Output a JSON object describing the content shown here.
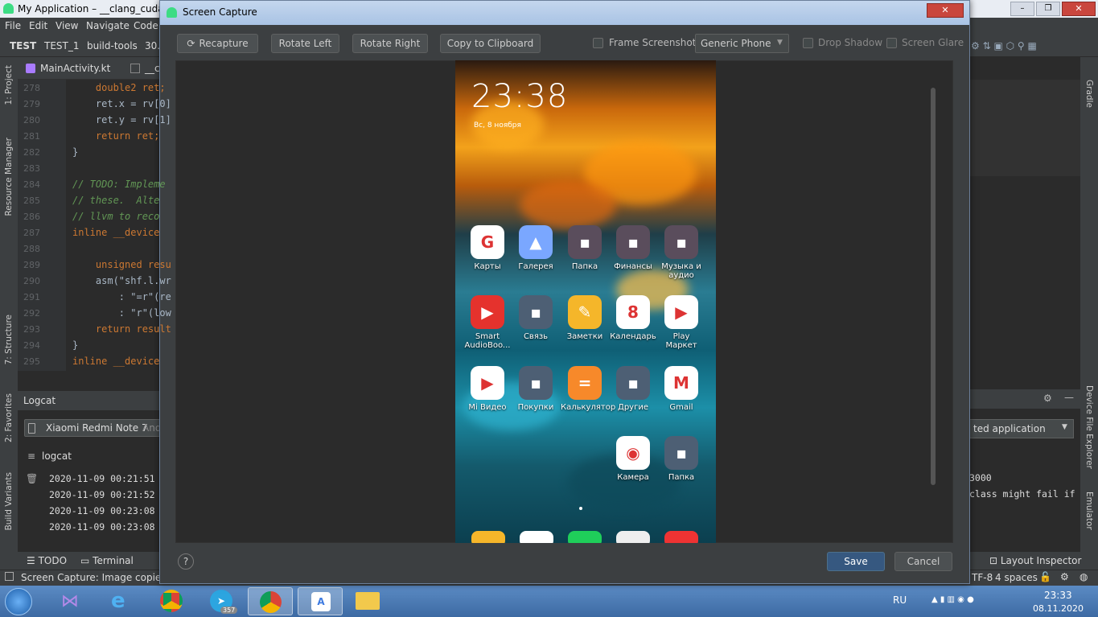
{
  "ide": {
    "title": "My Application – __clang_cuda_in",
    "menu": [
      "File",
      "Edit",
      "View",
      "Navigate",
      "Code"
    ],
    "breadcrumb": [
      "TEST",
      "TEST_1",
      "build-tools",
      "30."
    ],
    "tab_file": "MainActivity.kt",
    "tab_file2": "__c",
    "left_tools": [
      "1: Project",
      "Resource Manager",
      "7: Structure",
      "2: Favorites",
      "Build Variants"
    ],
    "right_tools": [
      "Gradle",
      "Device File Explorer",
      "Emulator"
    ],
    "code_lines": [
      {
        "n": "278",
        "t": "    double2 ret;"
      },
      {
        "n": "279",
        "t": "    ret.x = rv[0]"
      },
      {
        "n": "280",
        "t": "    ret.y = rv[1]"
      },
      {
        "n": "281",
        "t": "    return ret;"
      },
      {
        "n": "282",
        "t": "}"
      },
      {
        "n": "283",
        "t": ""
      },
      {
        "n": "284",
        "t": "// TODO: Impleme"
      },
      {
        "n": "285",
        "t": "// these.  Alte"
      },
      {
        "n": "286",
        "t": "// llvm to reco"
      },
      {
        "n": "287",
        "t": "inline __device"
      },
      {
        "n": "288",
        "t": ""
      },
      {
        "n": "289",
        "t": "    unsigned resu"
      },
      {
        "n": "290",
        "t": "    asm(\"shf.l.wr"
      },
      {
        "n": "291",
        "t": "        : \"=r\"(re"
      },
      {
        "n": "292",
        "t": "        : \"r\"(low"
      },
      {
        "n": "293",
        "t": "    return result"
      },
      {
        "n": "294",
        "t": "}"
      },
      {
        "n": "295",
        "t": "inline __device"
      }
    ],
    "logcat_title": "Logcat",
    "device": "Xiaomi Redmi Note 7",
    "device_suffix": "Andr",
    "logcat_label": "logcat",
    "log_lines": [
      "2020-11-09 00:21:51",
      "2020-11-09 00:21:52",
      "2020-11-09 00:23:08",
      "2020-11-09 00:23:08"
    ],
    "right_filter": "ted application",
    "right_log1": "3000",
    "right_log2": "class might fail if",
    "bottom_tabs": [
      "TODO",
      "Terminal"
    ],
    "layout_inspector": "Layout Inspector",
    "status_text": "Screen Capture: Image copied to",
    "encoding": "TF-8",
    "indent": "4 spaces"
  },
  "dialog": {
    "title": "Screen Capture",
    "recapture": "Recapture",
    "rotate_left": "Rotate Left",
    "rotate_right": "Rotate Right",
    "copy": "Copy to Clipboard",
    "frame_screenshot": "Frame Screenshot",
    "device_frame": "Generic Phone",
    "drop_shadow": "Drop Shadow",
    "screen_glare": "Screen Glare",
    "save": "Save",
    "cancel": "Cancel",
    "help": "?"
  },
  "phone": {
    "time": "23:38",
    "date": "Вс, 8 ноября",
    "apps": [
      {
        "label": "Карты",
        "color": "#ffffff",
        "glyph": "G"
      },
      {
        "label": "Галерея",
        "color": "#7aa7ff",
        "glyph": "▲"
      },
      {
        "label": "Папка",
        "color": "#5a4d5c",
        "glyph": "▪"
      },
      {
        "label": "Финансы",
        "color": "#5a4d5c",
        "glyph": "▪"
      },
      {
        "label": "Музыка и аудио",
        "color": "#5a4d5c",
        "glyph": "▪"
      },
      {
        "label": "Smart AudioBoo...",
        "color": "#e5322d",
        "glyph": "▶"
      },
      {
        "label": "Связь",
        "color": "#4d5f74",
        "glyph": "▪"
      },
      {
        "label": "Заметки",
        "color": "#f5b62a",
        "glyph": "✎"
      },
      {
        "label": "Календарь",
        "color": "#ffffff",
        "glyph": "8"
      },
      {
        "label": "Play Маркет",
        "color": "#ffffff",
        "glyph": "▶"
      },
      {
        "label": "Mi Видео",
        "color": "#ffffff",
        "glyph": "▶"
      },
      {
        "label": "Покупки",
        "color": "#4d5f74",
        "glyph": "▪"
      },
      {
        "label": "Калькулятор",
        "color": "#f7892a",
        "glyph": "="
      },
      {
        "label": "Другие",
        "color": "#4d5f74",
        "glyph": "▪"
      },
      {
        "label": "Gmail",
        "color": "#ffffff",
        "glyph": "M"
      },
      {
        "label": "Камера",
        "color": "#ffffff",
        "glyph": "◉"
      },
      {
        "label": "Папка",
        "color": "#4d5f74",
        "glyph": "▪"
      }
    ]
  },
  "taskbar": {
    "lang": "RU",
    "time": "23:33",
    "date": "08.11.2020",
    "telegram_badge": "357"
  }
}
